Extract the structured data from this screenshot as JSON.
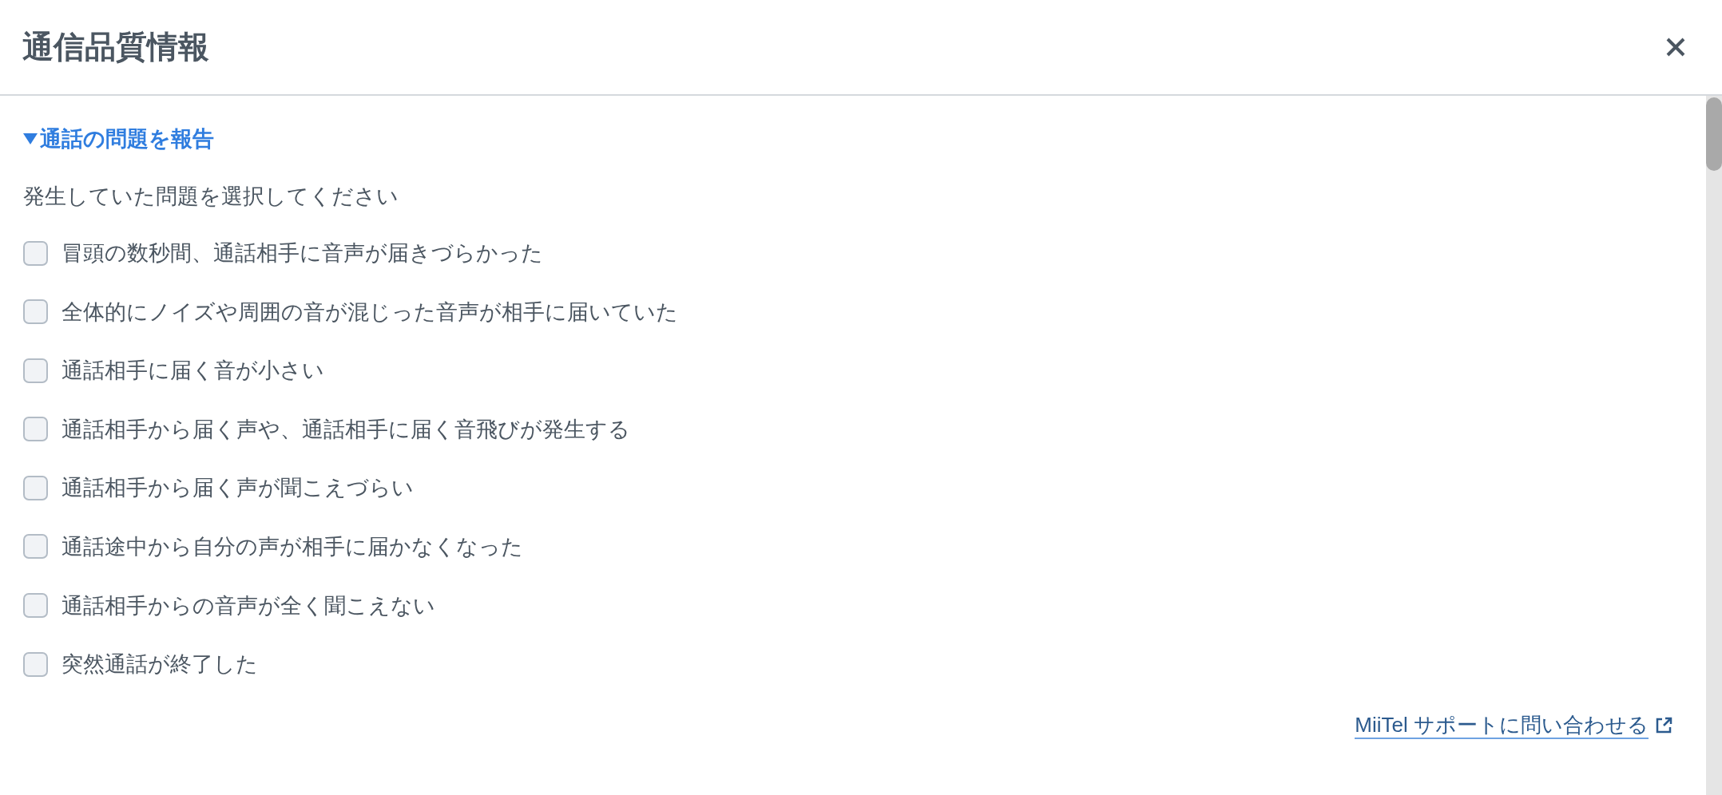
{
  "dialog": {
    "title": "通信品質情報"
  },
  "report": {
    "label": "通話の問題を報告",
    "expanded": true,
    "prompt": "発生していた問題を選択してください",
    "options": [
      {
        "label": "冒頭の数秒間、通話相手に音声が届きづらかった",
        "checked": false
      },
      {
        "label": "全体的にノイズや周囲の音が混じった音声が相手に届いていた",
        "checked": false
      },
      {
        "label": "通話相手に届く音が小さい",
        "checked": false
      },
      {
        "label": "通話相手から届く声や、通話相手に届く音飛びが発生する",
        "checked": false
      },
      {
        "label": "通話相手から届く声が聞こえづらい",
        "checked": false
      },
      {
        "label": "通話途中から自分の声が相手に届かなくなった",
        "checked": false
      },
      {
        "label": "通話相手からの音声が全く聞こえない",
        "checked": false
      },
      {
        "label": "突然通話が終了した",
        "checked": false
      }
    ]
  },
  "support_link": {
    "label": "MiiTel サポートに問い合わせる"
  }
}
